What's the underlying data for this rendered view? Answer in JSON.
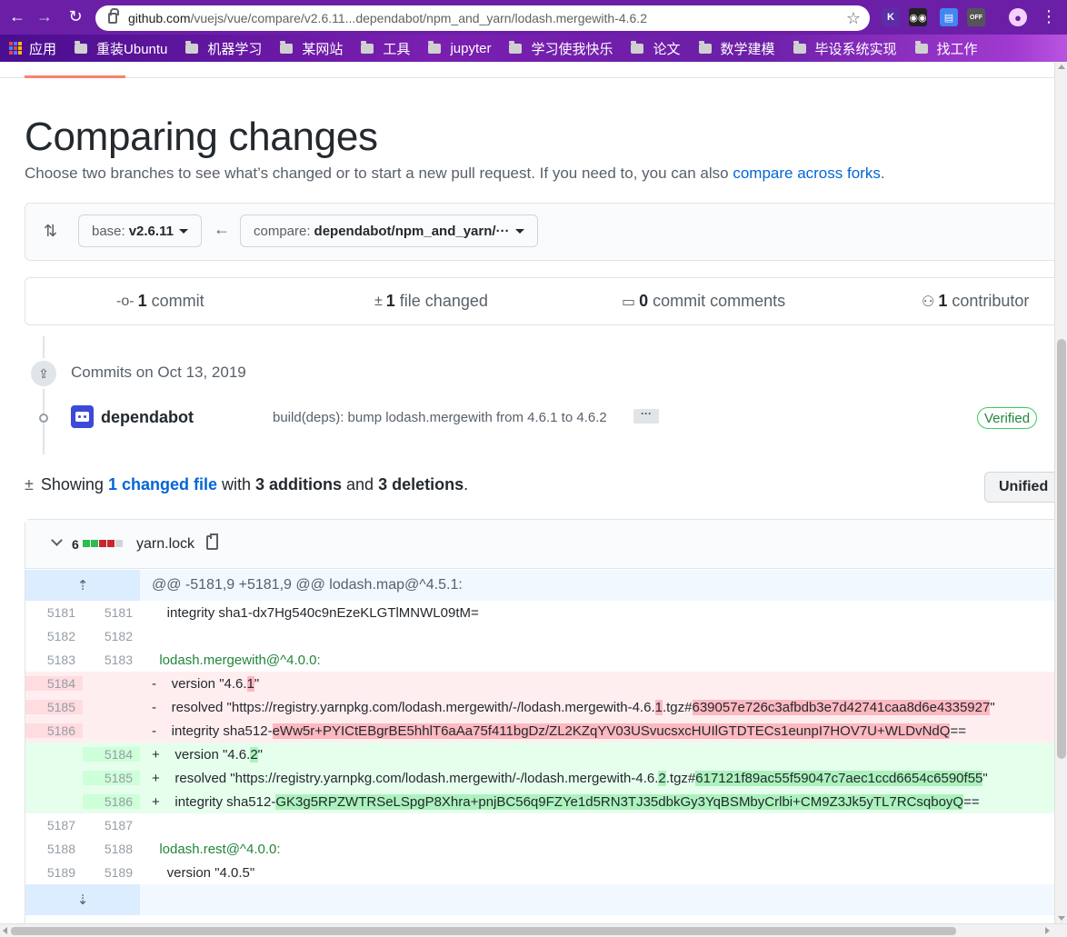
{
  "browser": {
    "url_host": "github.com",
    "url_path": "/vuejs/vue/compare/v2.6.11...dependabot/npm_and_yarn/lodash.mergewith-4.6.2",
    "extensions": [
      {
        "name": "k-icon",
        "label": "K",
        "color": "#5b2ea6"
      },
      {
        "name": "glasses-icon",
        "label": "◉◉",
        "color": "#222222"
      },
      {
        "name": "page-icon",
        "label": "▤",
        "color": "#4285f4"
      },
      {
        "name": "off-icon",
        "label": "OFF",
        "color": "#555555"
      }
    ]
  },
  "bookmarks": {
    "apps_label": "应用",
    "items": [
      "重装Ubuntu",
      "机器学习",
      "某网站",
      "工具",
      "jupyter",
      "学习使我快乐",
      "论文",
      "数学建模",
      "毕设系统实现",
      "找工作"
    ]
  },
  "page": {
    "title": "Comparing changes",
    "subtitle_pre": "Choose two branches to see what’s changed or to start a new pull request. If you need to, you can also ",
    "subtitle_link": "compare across forks",
    "subtitle_post": ".",
    "base_prefix": "base:",
    "base_value": "v2.6.11",
    "compare_prefix": "compare:",
    "compare_value": "dependabot/npm_and_yarn/···"
  },
  "summary": {
    "commits_num": "1",
    "commits_label": "commit",
    "files_num": "1",
    "files_label": "file changed",
    "comments_num": "0",
    "comments_label": "commit comments",
    "contributors_num": "1",
    "contributors_label": "contributor"
  },
  "timeline": {
    "date_label": "Commits on Oct 13, 2019",
    "author": "dependabot",
    "message": "build(deps): bump lodash.mergewith from 4.6.1 to 4.6.2",
    "ellipsis": "···",
    "verified": "Verified"
  },
  "showing": {
    "pre": "Showing",
    "files_link": "1 changed file",
    "with": "with",
    "additions": "3 additions",
    "and": "and",
    "deletions": "3 deletions",
    "period": ".",
    "view_button": "Unified"
  },
  "file": {
    "changes": "6",
    "diffstat_colors": [
      "#2cbe4e",
      "#2cbe4e",
      "#cb2431",
      "#cb2431",
      "#d1d5da"
    ],
    "name": "yarn.lock",
    "hunk_header": "@@ -5181,9 +5181,9 @@ lodash.map@^4.5.1:",
    "lines": [
      {
        "type": "ctx",
        "old": "5181",
        "new": "5181",
        "text": "    integrity sha1-dx7Hg540c9nEzeKLGTlMNWL09tM="
      },
      {
        "type": "ctx",
        "old": "5182",
        "new": "5182",
        "text": ""
      },
      {
        "type": "ctx",
        "old": "5183",
        "new": "5183",
        "text": "  lodash.mergewith@^4.0.0:"
      },
      {
        "type": "del",
        "old": "5184",
        "new": "",
        "sign": "-",
        "a": "    version \"4.6.",
        "hl": "1",
        "b": "\""
      },
      {
        "type": "del",
        "old": "5185",
        "new": "",
        "sign": "-",
        "a": "    resolved \"https://registry.yarnpkg.com/lodash.mergewith/-/lodash.mergewith-4.6.",
        "hl": "1",
        "b": ".tgz#",
        "hl2": "639057e726c3afbdb3e7d42741caa8d6e4335927",
        "c": "\""
      },
      {
        "type": "del",
        "old": "5186",
        "new": "",
        "sign": "-",
        "a": "    integrity sha512-",
        "hl": "eWw5r+PYICtEBgrBE5hhlT6aAa75f411bgDz/ZL2KZqYV03USvucsxcHUIlGTDTECs1eunpI7HOV7U+WLDvNdQ",
        "b": "=="
      },
      {
        "type": "add",
        "old": "",
        "new": "5184",
        "sign": "+",
        "a": "    version \"4.6.",
        "hl": "2",
        "b": "\""
      },
      {
        "type": "add",
        "old": "",
        "new": "5185",
        "sign": "+",
        "a": "    resolved \"https://registry.yarnpkg.com/lodash.mergewith/-/lodash.mergewith-4.6.",
        "hl": "2",
        "b": ".tgz#",
        "hl2": "617121f89ac55f59047c7aec1ccd6654c6590f55",
        "c": "\""
      },
      {
        "type": "add",
        "old": "",
        "new": "5186",
        "sign": "+",
        "a": "    integrity sha512-",
        "hl": "GK3g5RPZWTRSeLSpgP8Xhra+pnjBC56q9FZYe1d5RN3TJ35dbkGy3YqBSMbyCrlbi+CM9Z3Jk5yTL7RCsqboyQ",
        "b": "=="
      },
      {
        "type": "ctx",
        "old": "5187",
        "new": "5187",
        "text": ""
      },
      {
        "type": "ctx",
        "old": "5188",
        "new": "5188",
        "text": "  lodash.rest@^4.0.0:"
      },
      {
        "type": "ctx",
        "old": "5189",
        "new": "5189",
        "text": "    version \"4.0.5\""
      }
    ]
  }
}
